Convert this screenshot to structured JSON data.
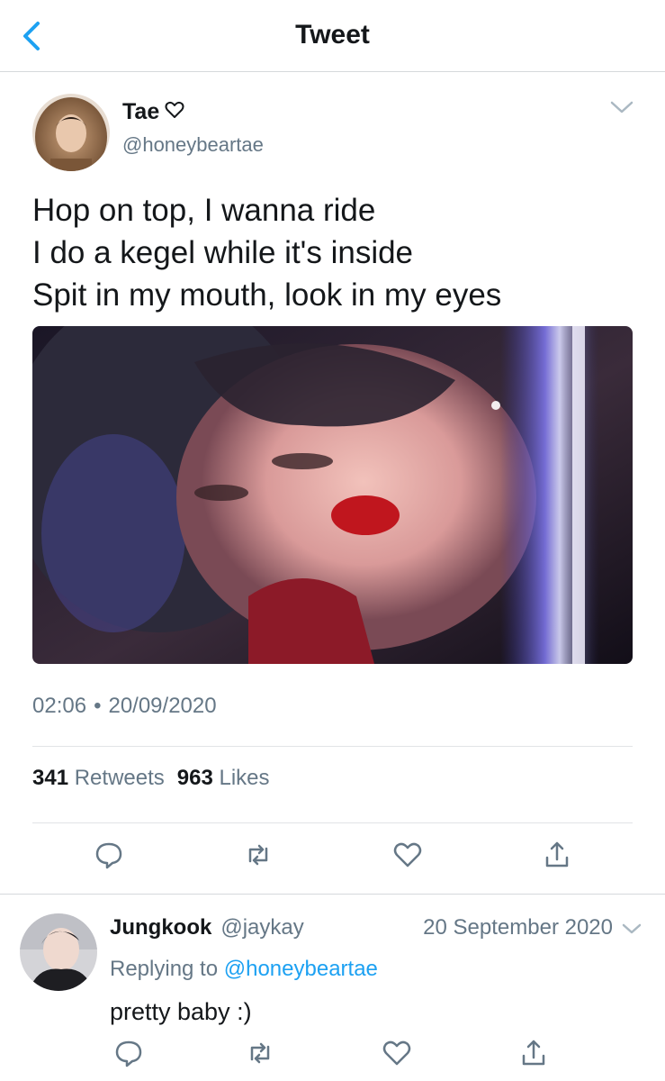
{
  "navbar": {
    "title": "Tweet"
  },
  "tweet": {
    "author_name": "Tae",
    "name_emoji": "♡",
    "author_handle": "@honeybeartae",
    "text_lines": [
      "Hop on top, I wanna ride",
      "I do a kegel while it's inside",
      "Spit in my mouth, look in my eyes"
    ],
    "time": "02:06",
    "dot": "•",
    "date": "20/09/2020",
    "retweets_count": "341",
    "retweets_label": "Retweets",
    "likes_count": "963",
    "likes_label": "Likes"
  },
  "reply": {
    "author_name": "Jungkook",
    "author_handle": "@jaykay",
    "date": "20 September 2020",
    "replying_prefix": "Replying to",
    "replying_to": "@honeybeartae",
    "text": "pretty baby :)"
  },
  "icons": {
    "back": "chevron-left-icon",
    "caret": "chevron-down-icon",
    "reply": "comment-icon",
    "retweet": "retweet-icon",
    "like": "heart-icon",
    "share": "share-icon"
  },
  "colors": {
    "accent": "#1da1f2",
    "text": "#14171a",
    "secondary": "#657786",
    "divider": "#e1e4e6"
  }
}
